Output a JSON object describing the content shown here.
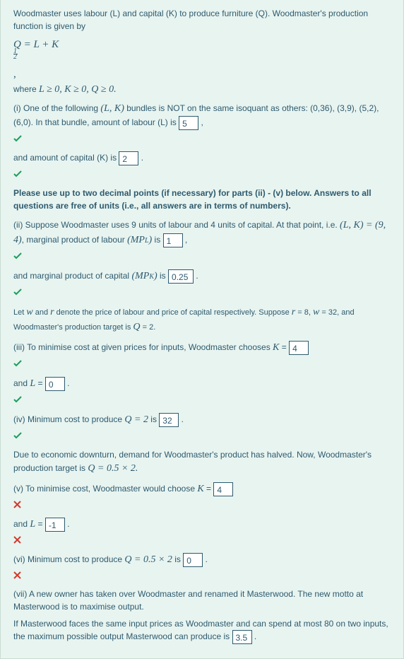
{
  "intro": "Woodmaster uses labour (L) and capital (K) to produce furniture (Q). Woodmaster's production function is given by",
  "eq_main": "Q = L + K",
  "eq_exp_num": "1",
  "eq_exp_den": "2",
  "eq_tail": ",",
  "where_prefix": "where ",
  "where_math": "L ≥ 0, K ≥ 0, Q ≥ 0.",
  "part_i_a": "(i) One of the following ",
  "part_i_b": "(L, K)",
  "part_i_c": " bundles is NOT on the same isoquant as others: (0,36), (3,9), (5,2), (6,0). In that bundle, amount of labour (L) is ",
  "ans_i_L": "5",
  "cap_line": "and amount of capital (K) is ",
  "ans_i_K": "2",
  "note": "Please use up to two decimal points (if necessary) for parts (ii) - (v) below. Answers to all questions are free of units (i.e., all answers are in terms of numbers).",
  "part_ii_a": "(ii) Suppose Woodmaster uses 9 units of labour and 4 units of capital. At that point, i.e. ",
  "part_ii_b": "(L, K) = (9, 4)",
  "part_ii_c": ", marginal product of labour ",
  "mpl_sym": "(MP",
  "mpl_sub": "L",
  "mpl_close": ")",
  "is_txt": " is ",
  "ans_ii_mpl": "1",
  "mpk_line_a": "and marginal product of capital ",
  "mpk_sym": "(MP",
  "mpk_sub": "K",
  "mpk_close": ")",
  "ans_ii_mpk": "0.25",
  "price_line_a": "Let ",
  "price_w": "w",
  "price_line_b": " and ",
  "price_r": "r",
  "price_line_c": " denote the price of labour and price of capital respectively. Suppose ",
  "price_r2": "r",
  "eq_sym": " = ",
  "price_rv": "8, ",
  "price_w2": "w",
  "price_wv": "32",
  "price_tail": ", and Woodmaster's production target is ",
  "q_sym": "Q",
  "q_eq": " = 2.",
  "part_iii": "(iii) To minimise cost at given prices for inputs, Woodmaster chooses ",
  "k_sym": "K",
  "eq_sym2": " = ",
  "ans_iii_K": "4",
  "and_txt": "and ",
  "l_sym": "L",
  "ans_iii_L": "0",
  "part_iv_a": "(iv) Minimum cost to produce ",
  "part_iv_q": "Q = 2",
  "ans_iv": "32",
  "downturn": "Due to economic downturn, demand for Woodmaster's product has halved. Now, Woodmaster's production target is ",
  "downturn_q": "Q = 0.5 × 2.",
  "part_v": "(v) To minimise cost, Woodmaster would choose ",
  "ans_v_K": "4",
  "ans_v_L": "-1",
  "part_vi_a": "(vi) Minimum cost to produce ",
  "part_vi_q": "Q = 0.5 × 2",
  "ans_vi": "0",
  "part_vii": "(vii) A new owner has taken over Woodmaster and renamed it Masterwood. The new motto at Masterwood is to maximise output.",
  "part_vii_b": "If Masterwood faces the same input prices as Woodmaster and can spend at most 80 on two inputs, the maximum possible output Masterwood can produce is ",
  "ans_vii": "3.5"
}
